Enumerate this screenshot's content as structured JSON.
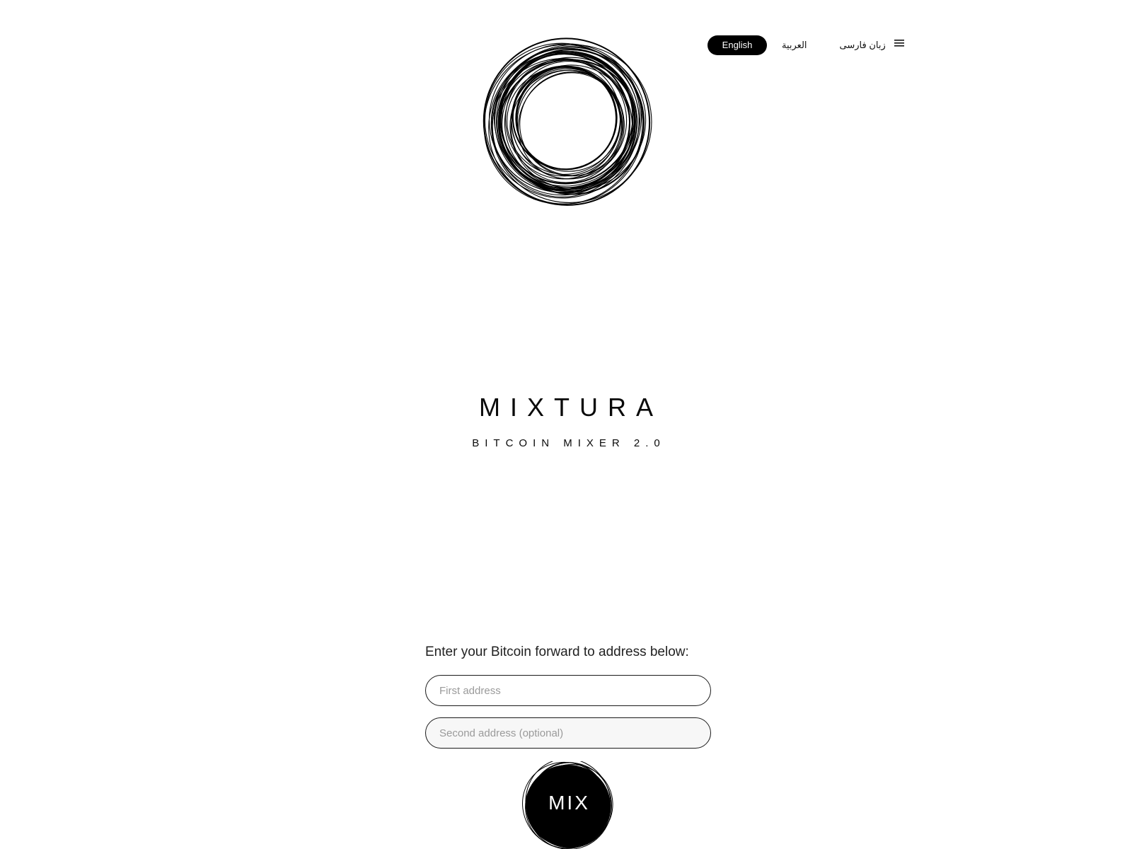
{
  "languages": {
    "english": "English",
    "arabic": "العربية",
    "farsi": "زبان فارسی"
  },
  "menu": {
    "icon": "hamburger-menu-icon"
  },
  "logo": {
    "icon": "scribble-circle-logo"
  },
  "brand": {
    "title": "MIXTURA",
    "subtitle": "BITCOIN MIXER 2.0"
  },
  "form": {
    "label": "Enter your Bitcoin forward to address below:",
    "first_placeholder": "First address",
    "second_placeholder": "Second address (optional)",
    "submit_label": "MIX"
  },
  "colors": {
    "accent": "#000000",
    "background": "#ffffff"
  }
}
